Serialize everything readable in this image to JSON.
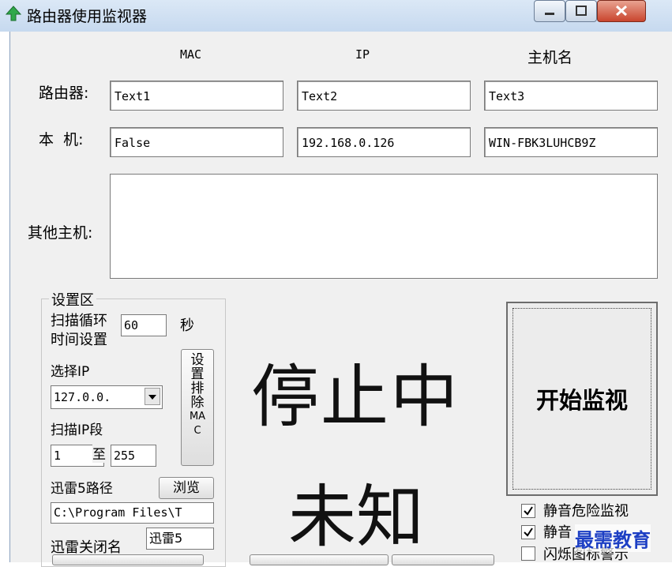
{
  "window": {
    "title": "路由器使用监视器"
  },
  "columns": {
    "mac": "MAC",
    "ip": "IP",
    "hostname": "主机名"
  },
  "router": {
    "label": "路由器:",
    "mac": "Text1",
    "ip": "Text2",
    "hostname": "Text3"
  },
  "local": {
    "label": "本  机:",
    "mac": "False",
    "ip": "192.168.0.126",
    "hostname": "WIN-FBK3LUHCB9Z"
  },
  "others": {
    "label": "其他主机:"
  },
  "settings": {
    "title": "设置区",
    "scan_interval_label_1": "扫描循环",
    "scan_interval_label_2": "时间设置",
    "scan_interval_value": "60",
    "seconds_unit": "秒",
    "select_ip_label": "选择IP",
    "ip_select_value": "127.0.0.",
    "exclude_mac_button": [
      "设",
      "置",
      "排",
      "除",
      "MA",
      "C"
    ],
    "scan_range_label": "扫描IP段",
    "range_from": "1",
    "range_to_label": "至",
    "range_to": "255",
    "thunder_path_label": "迅雷5路径",
    "browse_button": "浏览",
    "thunder_path_value": "C:\\Program Files\\T",
    "thunder_close_label": "迅雷关闭名",
    "thunder_close_value": "迅雷5"
  },
  "status": {
    "state": "停止中",
    "result": "未知"
  },
  "start_button": "开始监视",
  "options": [
    {
      "label": "静音危险监视",
      "checked": true
    },
    {
      "label": "静音",
      "checked": true
    },
    {
      "label": "闪烁图标警示",
      "checked": false
    }
  ],
  "watermark": "最需教育"
}
